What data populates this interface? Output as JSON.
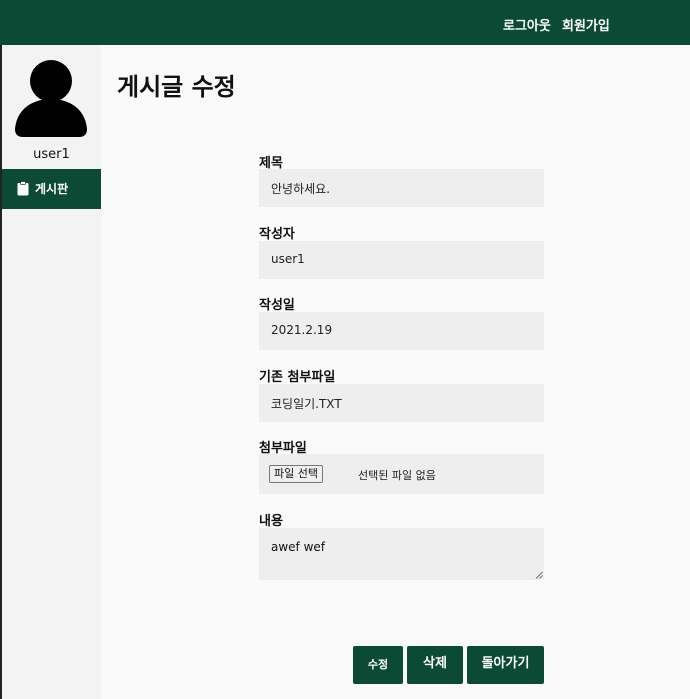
{
  "topbar": {
    "links": [
      "로그아웃",
      "회원가입"
    ]
  },
  "sidebar": {
    "username": "user1",
    "items": [
      {
        "label": "게시판",
        "icon": "clipboard-icon"
      }
    ]
  },
  "main": {
    "title": "게시글 수정",
    "fields": {
      "title": {
        "label": "제목",
        "value": "안녕하세요."
      },
      "author": {
        "label": "작성자",
        "value": "user1"
      },
      "date": {
        "label": "작성일",
        "value": "2021.2.19"
      },
      "existing_file": {
        "label": "기존 첨부파일",
        "value": "코딩일기.TXT"
      },
      "attachment": {
        "label": "첨부파일",
        "button": "파일 선택",
        "status": "선택된 파일 없음"
      },
      "content": {
        "label": "내용",
        "value": "awef wef"
      }
    },
    "buttons": {
      "edit": "수정",
      "delete": "삭제",
      "back": "돌아가기"
    }
  },
  "colors": {
    "brand": "#0b4a35",
    "field_bg": "#eeeeee",
    "page_bg": "#fafafa"
  }
}
